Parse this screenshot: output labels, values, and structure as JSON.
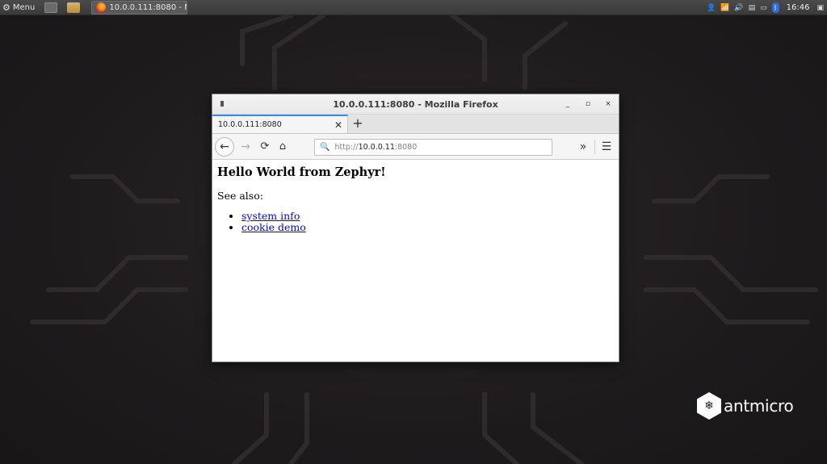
{
  "panel": {
    "menu_label": "Menu",
    "task_label": "10.0.0.111:8080 - M...",
    "clock": "16:46"
  },
  "window": {
    "title": "10.0.0.111:8080 - Mozilla Firefox",
    "minimize": "_",
    "maximize": "▫",
    "close": "×"
  },
  "tabs": [
    {
      "label": "10.0.0.111:8080"
    }
  ],
  "newtab_label": "+",
  "urlbar": {
    "scheme": "http://",
    "host": "10.0.0.11",
    "port": ":8080"
  },
  "page": {
    "heading": "Hello World from Zephyr!",
    "see_also": "See also:",
    "links": [
      {
        "label": "system info"
      },
      {
        "label": "cookie demo"
      }
    ]
  },
  "logo": {
    "text": "antmicro"
  },
  "icons": {
    "menu": "gear-icon",
    "back": "arrow-left-icon",
    "forward": "arrow-right-icon",
    "reload": "reload-icon",
    "home": "home-icon",
    "search": "search-icon",
    "overflow": "chevron-double-right-icon",
    "hamburger": "hamburger-menu-icon"
  },
  "colors": {
    "tab_accent": "#3b8be0",
    "link": "#0000ee"
  }
}
